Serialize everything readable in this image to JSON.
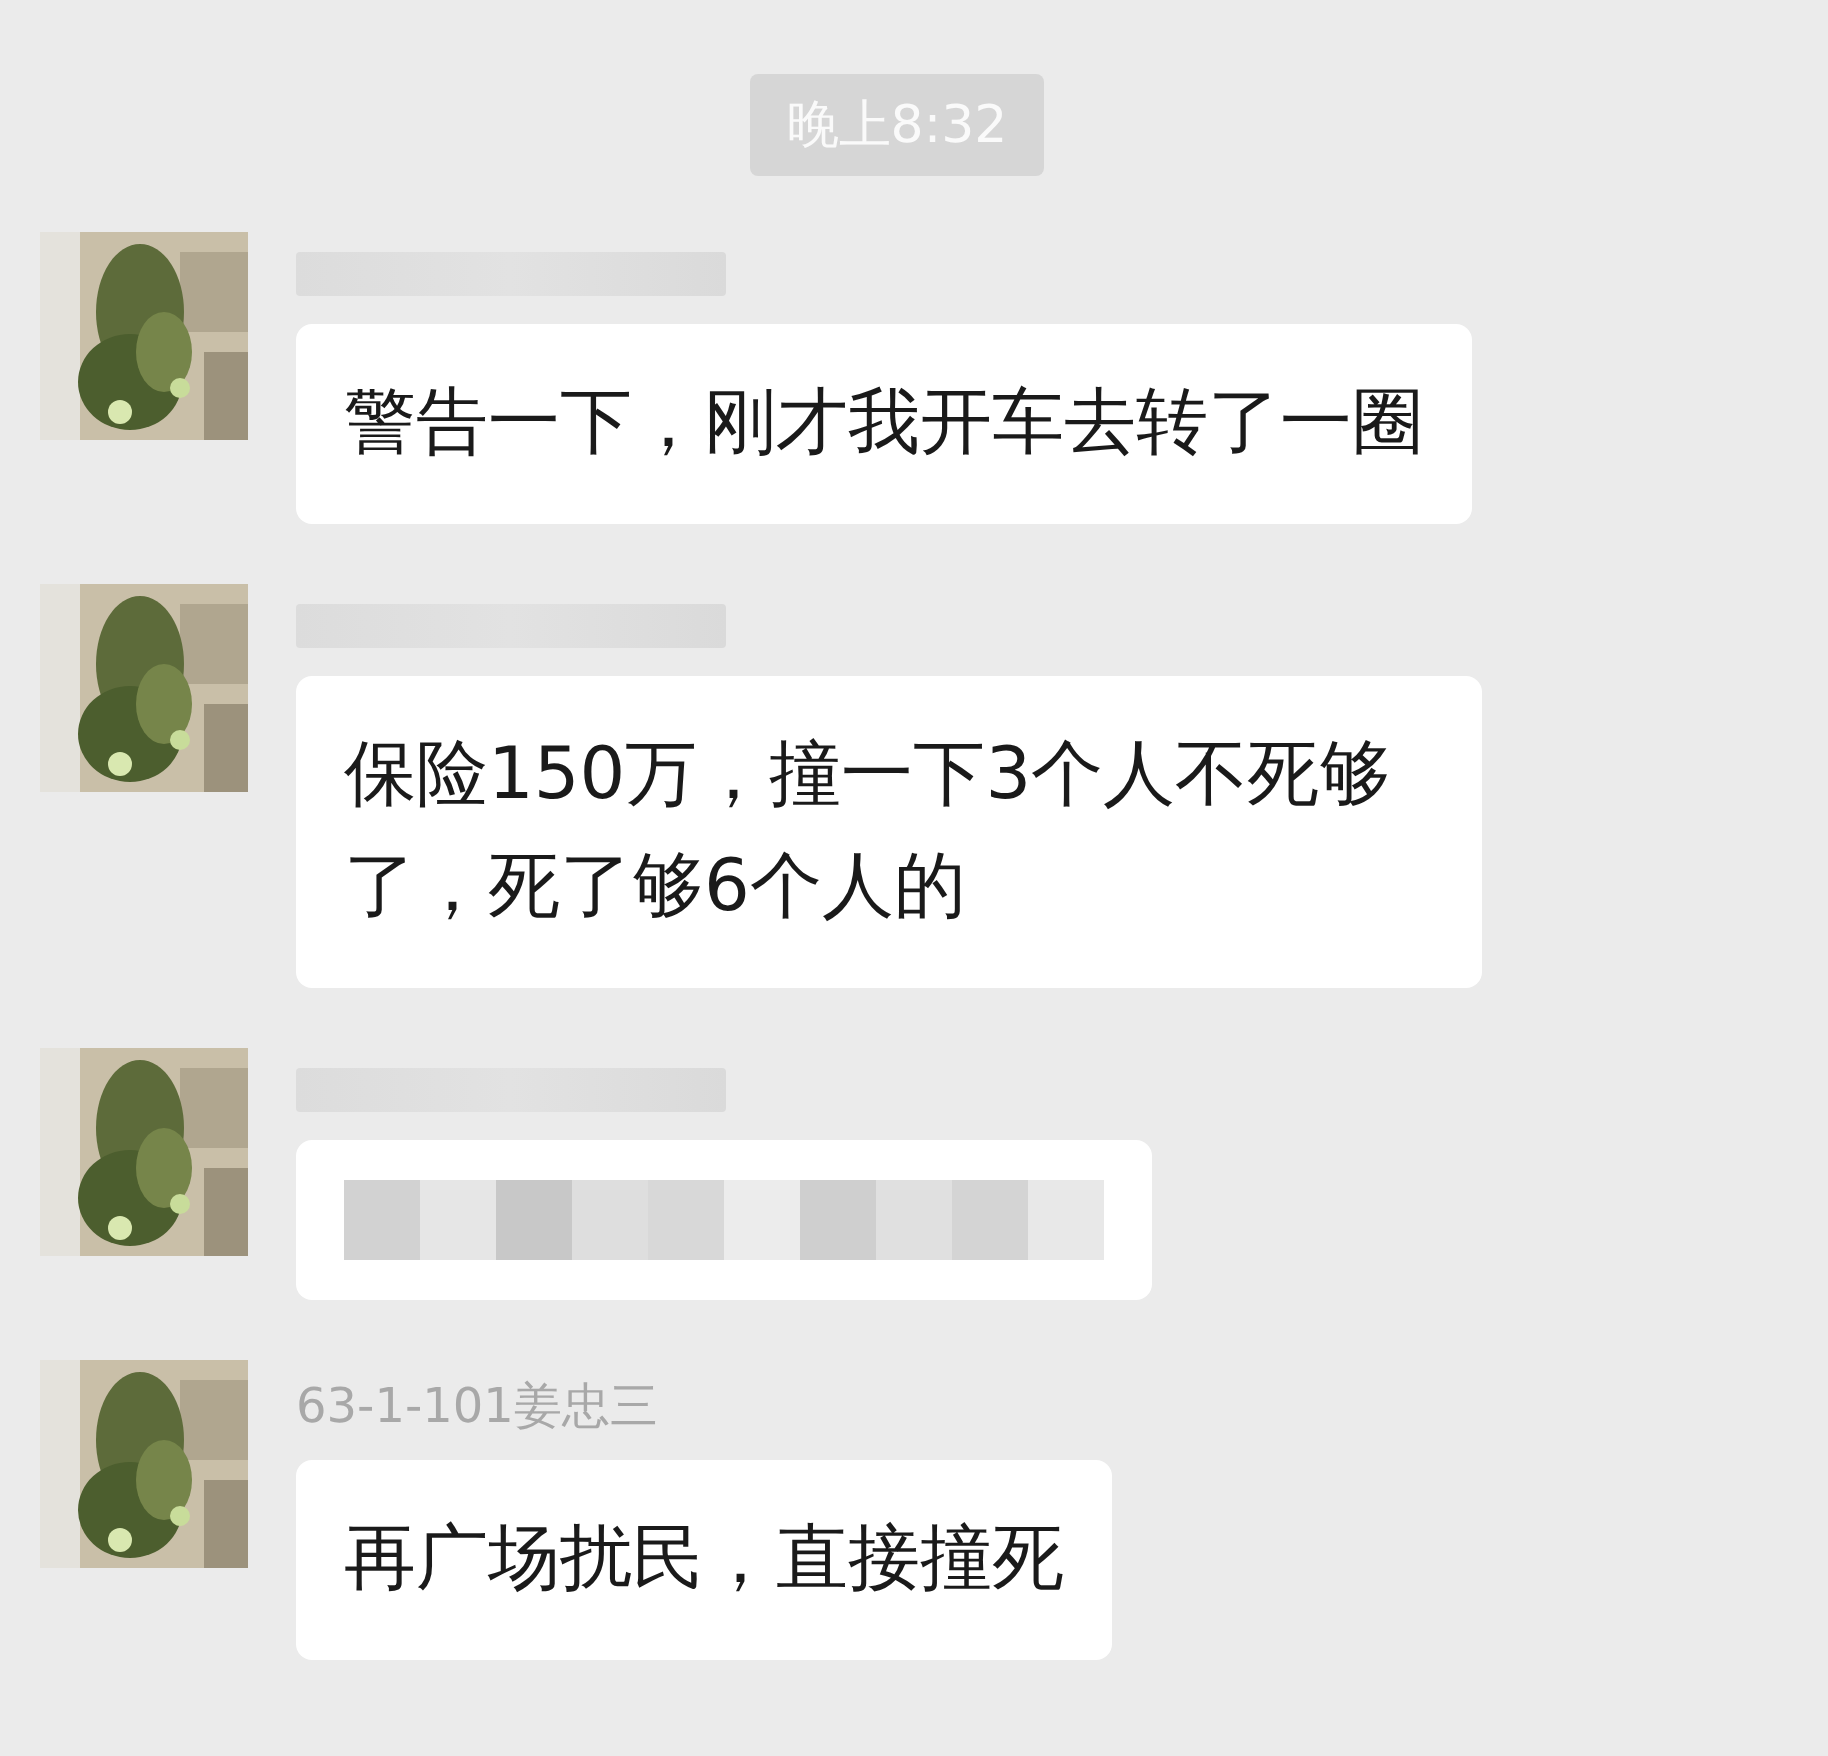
{
  "timestamp": "晚上8:32",
  "messages": [
    {
      "sender": {
        "kind": "blurred"
      },
      "body": {
        "kind": "text",
        "text": "警告一下，刚才我开车去转了一圈"
      }
    },
    {
      "sender": {
        "kind": "blurred"
      },
      "body": {
        "kind": "text",
        "text": "保险150万，撞一下3个人不死够了，死了够6个人的"
      }
    },
    {
      "sender": {
        "kind": "blurred"
      },
      "body": {
        "kind": "blurred"
      }
    },
    {
      "sender": {
        "kind": "name",
        "text": "63-1-101姜忠三"
      },
      "body": {
        "kind": "text",
        "text": "再广场扰民，直接撞死"
      }
    }
  ]
}
